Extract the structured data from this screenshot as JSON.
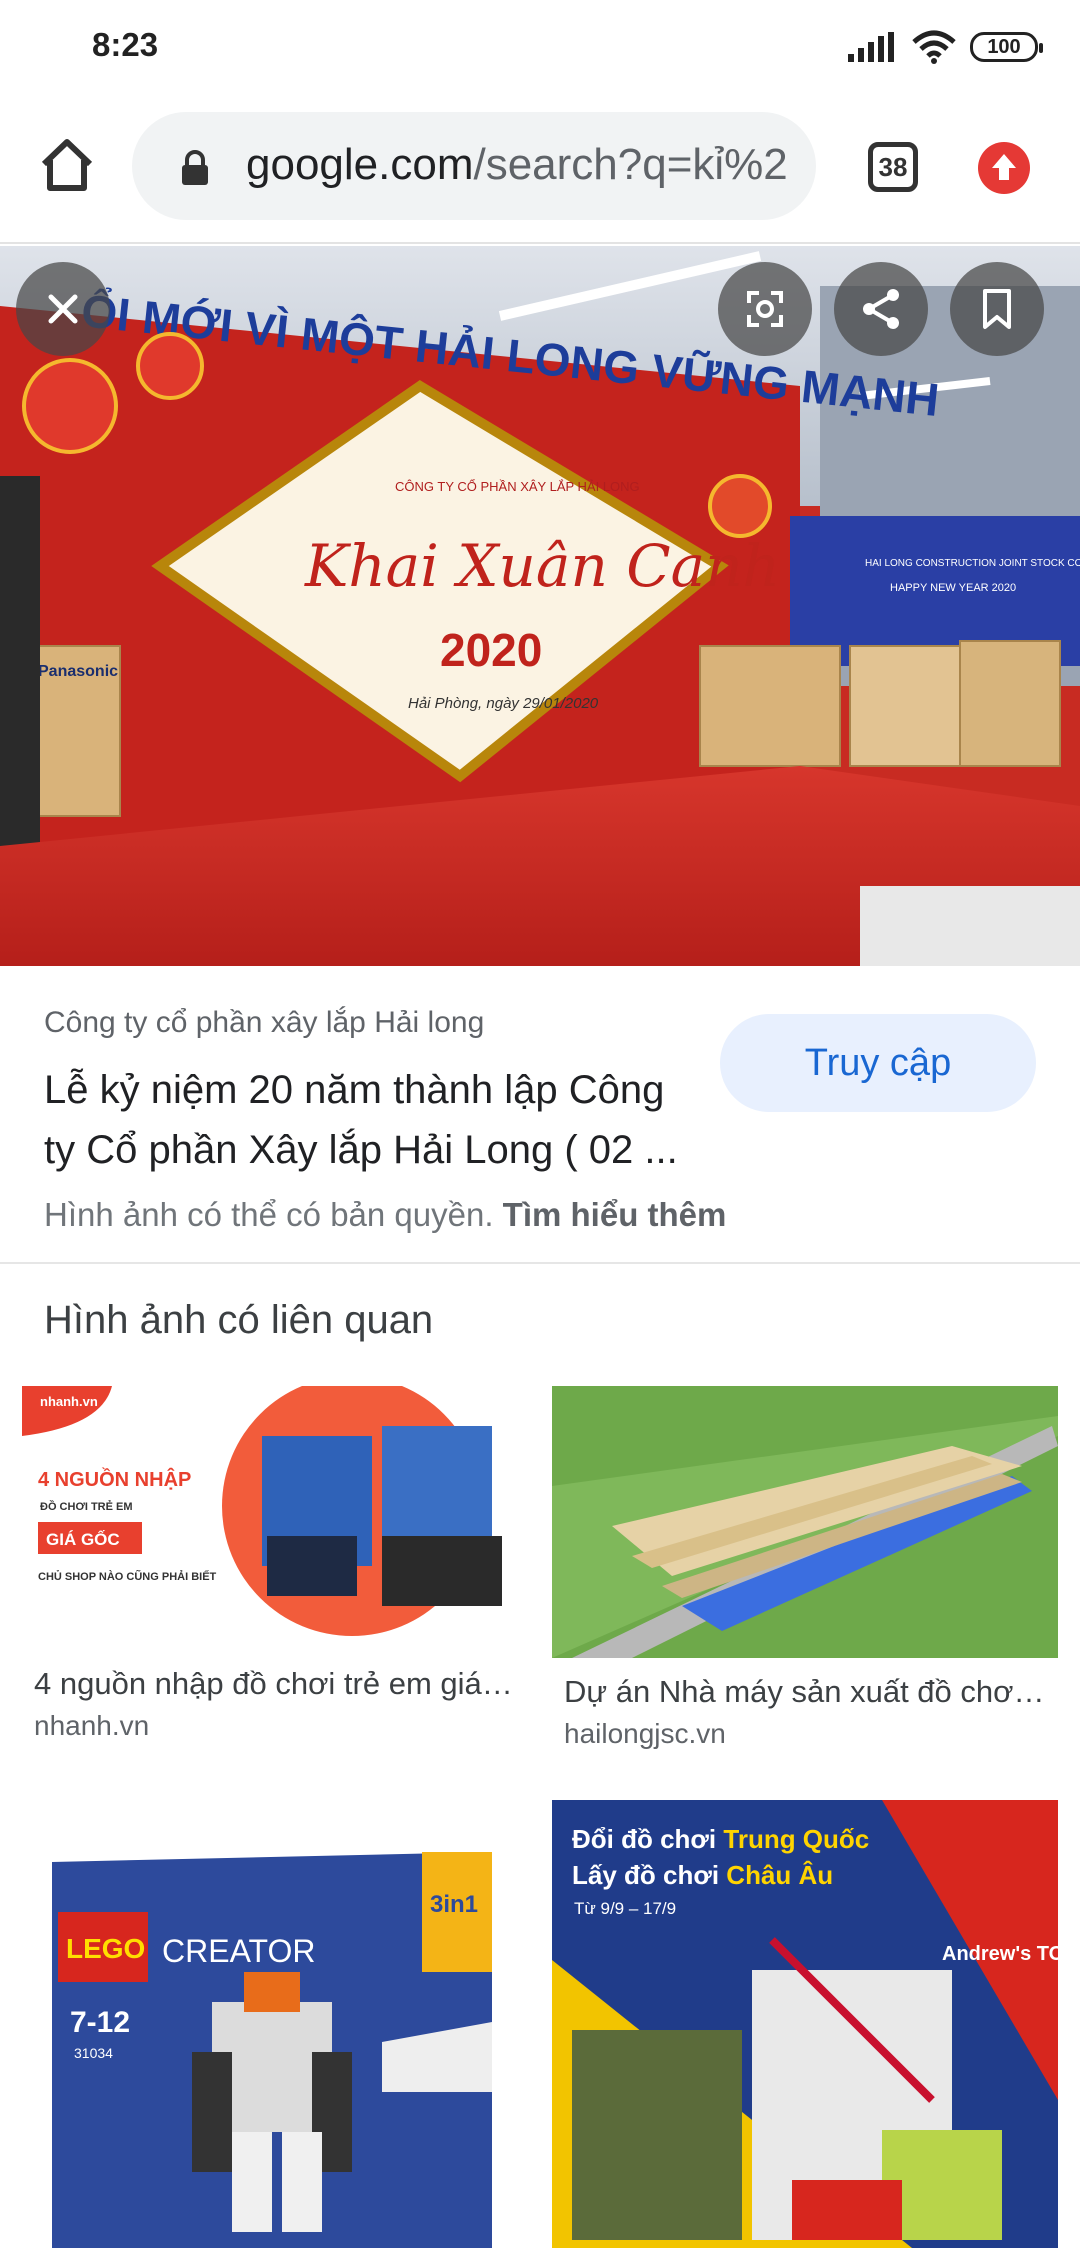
{
  "status_bar": {
    "time": "8:23",
    "battery": "100",
    "icons": [
      "signal-icon",
      "wifi-icon",
      "battery-icon"
    ]
  },
  "toolbar": {
    "url_host": "google.com",
    "url_path": "/search?q=kỉ%2",
    "tab_count": "38",
    "icons": [
      "home-icon",
      "lock-icon",
      "tabs-icon",
      "update-icon"
    ]
  },
  "hero": {
    "banner_text": "Khai Xuân Canh Tý",
    "banner_year": "2020",
    "banner_company": "CÔNG TY CỔ PHẦN XÂY LẮP HẢI LONG",
    "banner_date": "Hải Phòng, ngày 29/01/2020",
    "wall_text": "ỔI MỚI VÌ MỘT HẢI LONG VỮNG MẠNH",
    "side_text": "HAI LONG CONSTRUCTION JOINT STOCK COMPANY",
    "side_text2": "HAPPY NEW YEAR 2020",
    "box_brand": "Panasonic",
    "icons": [
      "close-icon",
      "lens-icon",
      "share-icon",
      "bookmark-icon"
    ]
  },
  "result": {
    "source": "Công ty cổ phần xây lắp Hải long",
    "title": "Lễ kỷ niệm 20 năm thành lập Công ty Cổ phần Xây lắp Hải Long ( 02 ...",
    "visit_label": "Truy cập",
    "copyright_text": "Hình ảnh có thể có bản quyền.",
    "learn_more": "Tìm hiểu thêm"
  },
  "related": {
    "heading": "Hình ảnh có liên quan",
    "items": [
      {
        "caption": "4 nguồn nhập đồ chơi trẻ em giá ...",
        "domain": "nhanh.vn",
        "img_line1": "4 NGUỒN NHẬP",
        "img_line2": "ĐỒ CHƠI TRẺ EM",
        "img_badge": "GIÁ GỐC",
        "img_line3": "CHỦ SHOP NÀO CŨNG PHẢI BIẾT",
        "img_logo": "nhanh.vn"
      },
      {
        "caption": "Dự án Nhà máy sản xuất đồ chơi ...",
        "domain": "hailongjsc.vn"
      },
      {
        "img_brand": "LEGO",
        "img_title": "CREATOR",
        "img_age": "7-12",
        "img_set": "31034",
        "img_badge": "3in1"
      },
      {
        "img_line1a": "Đổi đồ chơi ",
        "img_line1b": "Trung Quốc",
        "img_line2a": "Lấy đồ chơi ",
        "img_line2b": "Châu Âu",
        "img_dates": "Từ 9/9 – 17/9",
        "img_logo": "Andrew's TOYS"
      }
    ]
  }
}
